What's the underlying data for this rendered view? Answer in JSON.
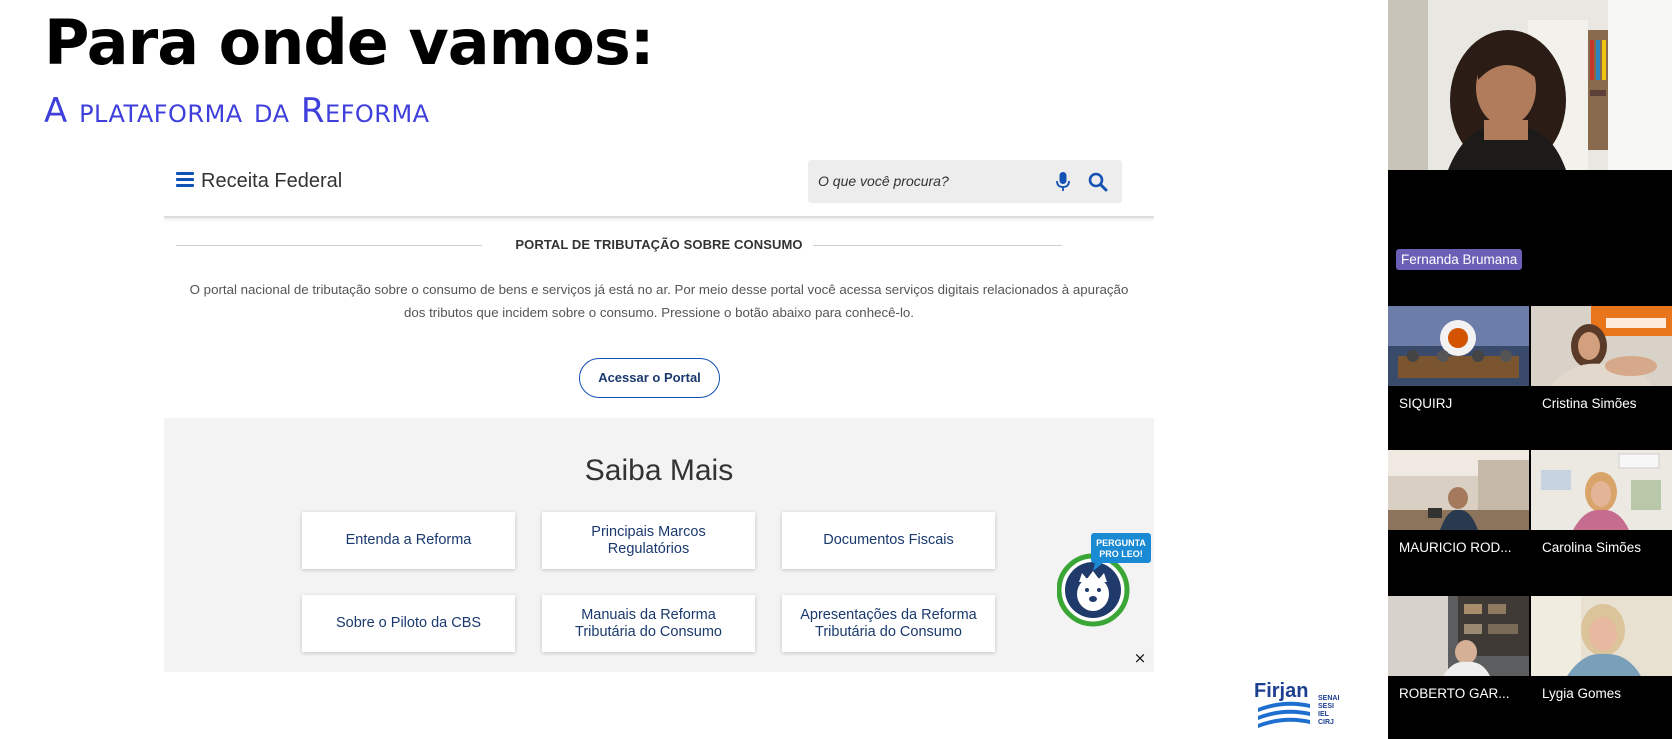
{
  "slide": {
    "title": "Para onde vamos:",
    "subtitle": "A plataforma da Reforma"
  },
  "site": {
    "brand": "Receita Federal",
    "search": {
      "placeholder": "O que você procura?"
    },
    "section_title": "PORTAL DE TRIBUTAÇÃO SOBRE CONSUMO",
    "section_description": "O portal nacional de tributação sobre o consumo de bens e serviços já está no ar. Por meio desse portal você acessa serviços digitais relacionados à apuração dos tributos que incidem sobre o consumo. Pressione o botão abaixo para conhecê-lo.",
    "portal_button": "Acessar o Portal",
    "saiba_mais": {
      "title": "Saiba Mais",
      "cards": [
        "Entenda a Reforma",
        "Principais Marcos Regulatórios",
        "Documentos Fiscais",
        "Sobre o Piloto da CBS",
        "Manuais da Reforma Tributária do Consumo",
        "Apresentações da Reforma Tributária do Consumo"
      ]
    },
    "leo_badge": {
      "line1": "PERGUNTA",
      "line2": "PRO LEO!"
    },
    "close_symbol": "×"
  },
  "logo": {
    "name": "Firjan",
    "sub": [
      "SENAI",
      "SESI",
      "IEL",
      "CIRJ"
    ]
  },
  "participants": [
    {
      "name": "Fernanda Brumana"
    },
    {
      "name": "SIQUIRJ"
    },
    {
      "name": "Cristina Simões"
    },
    {
      "name": "MAURICIO ROD..."
    },
    {
      "name": "Carolina Simões"
    },
    {
      "name": "ROBERTO  GAR..."
    },
    {
      "name": "Lygia Gomes"
    }
  ],
  "colors": {
    "accent_blue": "#1351b4",
    "subtitle": "#3f3fdc",
    "name_badge": "#6a5fb6"
  }
}
